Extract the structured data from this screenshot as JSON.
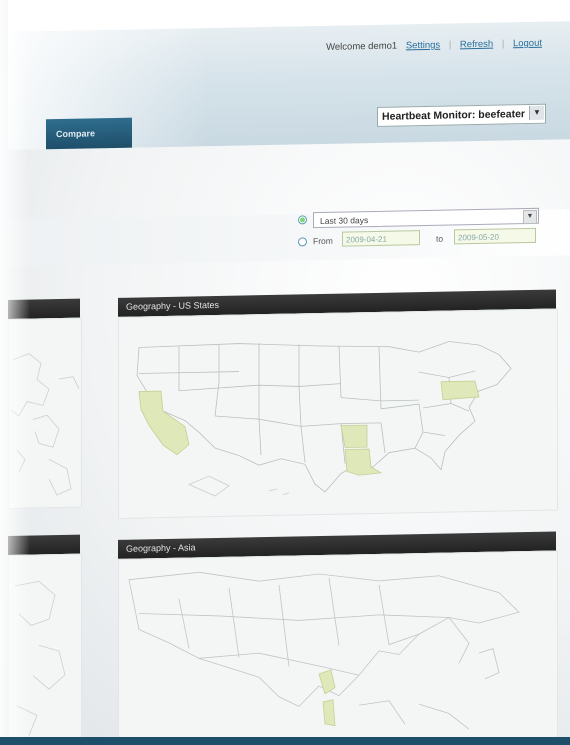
{
  "header": {
    "welcome_text": "Welcome demo1",
    "links": [
      "Settings",
      "Refresh",
      "Logout"
    ]
  },
  "nav": {
    "compare_tab": "Compare"
  },
  "monitor_select": {
    "value": "Heartbeat Monitor: beefeater"
  },
  "date_range": {
    "preset_value": "Last 30 days",
    "from_label": "From",
    "from_value": "2009-04-21",
    "to_label": "to",
    "to_value": "2009-05-20"
  },
  "panels": [
    {
      "title": "Geography - US States"
    },
    {
      "title": "Geography - Asia"
    }
  ],
  "colors": {
    "header_bg": "#d6e3ea",
    "tab_bg": "#1e4f6a",
    "panel_header": "#2a2a2a",
    "highlight_state": "#dfe8b8",
    "accent_green": "#7fd67a"
  }
}
